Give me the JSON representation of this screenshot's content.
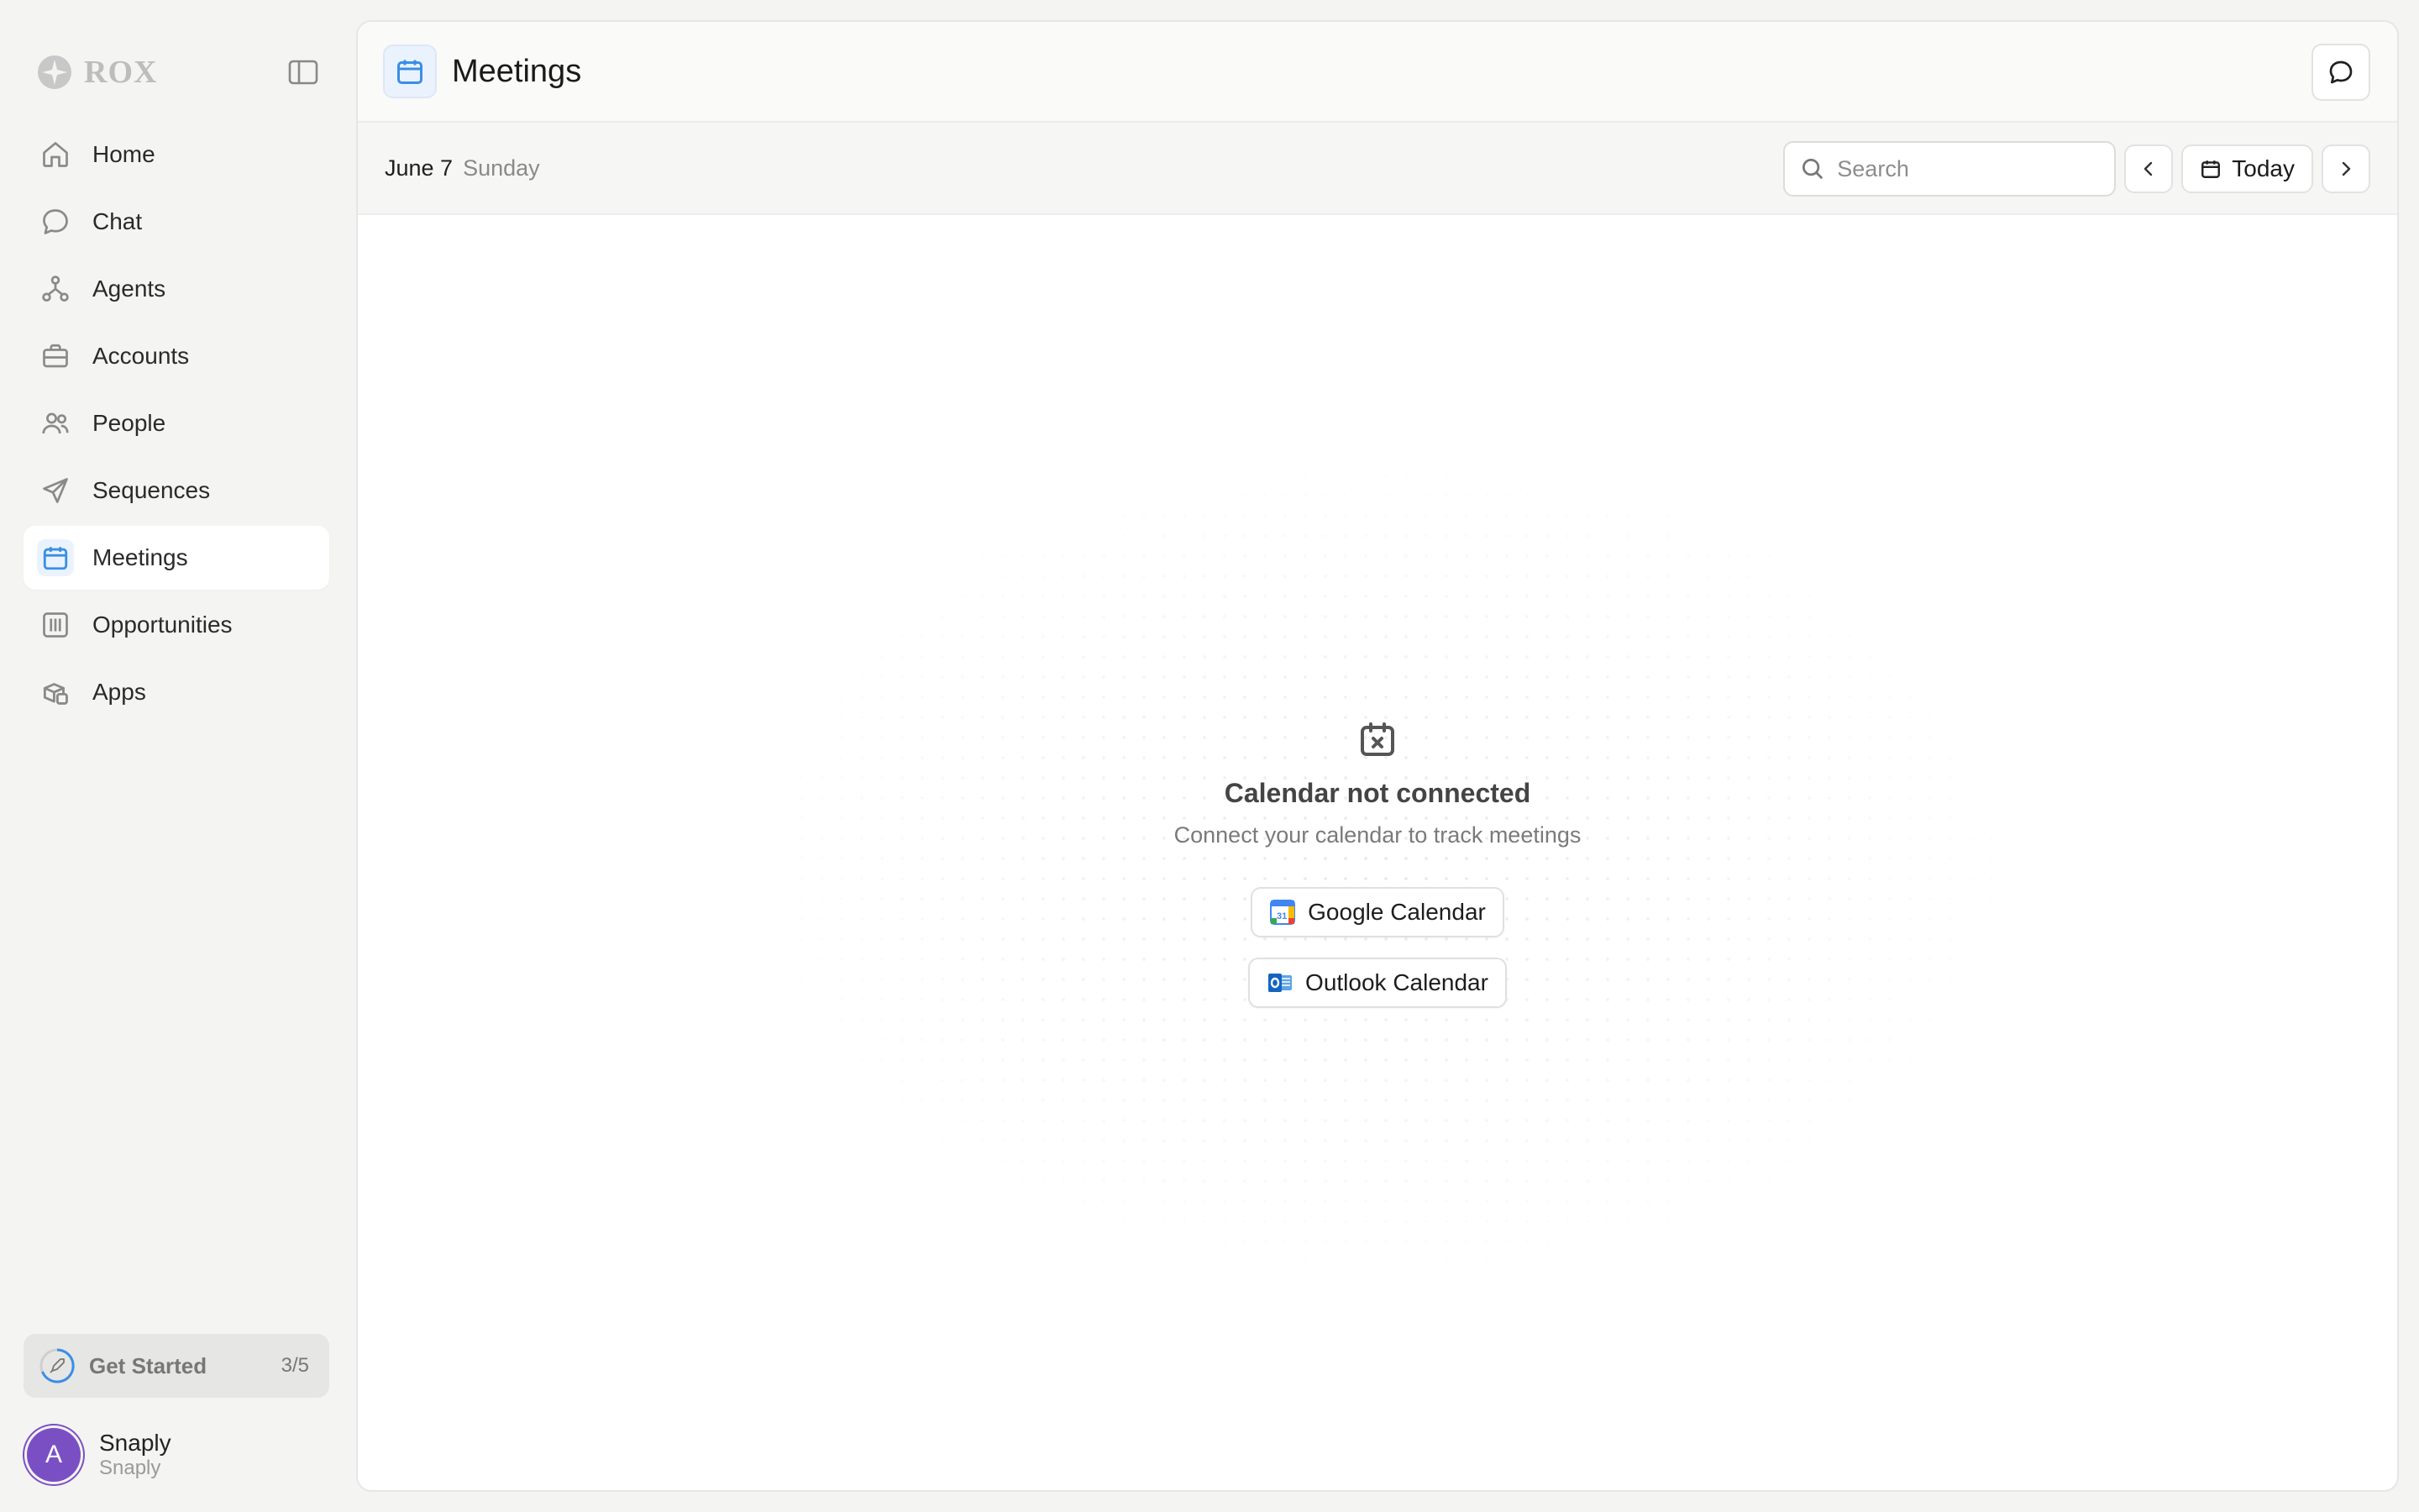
{
  "brand": {
    "name": "ROX"
  },
  "sidebar": {
    "items": [
      {
        "label": "Home",
        "icon": "home-icon"
      },
      {
        "label": "Chat",
        "icon": "chat-bubble-icon"
      },
      {
        "label": "Agents",
        "icon": "agents-icon"
      },
      {
        "label": "Accounts",
        "icon": "briefcase-icon"
      },
      {
        "label": "People",
        "icon": "people-icon"
      },
      {
        "label": "Sequences",
        "icon": "paper-plane-icon"
      },
      {
        "label": "Meetings",
        "icon": "calendar-icon",
        "active": true
      },
      {
        "label": "Opportunities",
        "icon": "kanban-icon"
      },
      {
        "label": "Apps",
        "icon": "apps-icon"
      }
    ],
    "get_started": {
      "label": "Get Started",
      "count": "3/5"
    },
    "user": {
      "initial": "A",
      "name": "Snaply",
      "org": "Snaply"
    }
  },
  "header": {
    "title": "Meetings"
  },
  "toolbar": {
    "date": "June 7",
    "weekday": "Sunday",
    "search_placeholder": "Search",
    "today_label": "Today"
  },
  "empty_state": {
    "title": "Calendar not connected",
    "subtitle": "Connect your calendar to track meetings",
    "google_label": "Google Calendar",
    "outlook_label": "Outlook Calendar"
  },
  "colors": {
    "accent": "#3a8ee6",
    "active_bg": "#eaf3fd",
    "avatar": "#7b4fc4",
    "icon_gray": "#8a8a8a"
  }
}
